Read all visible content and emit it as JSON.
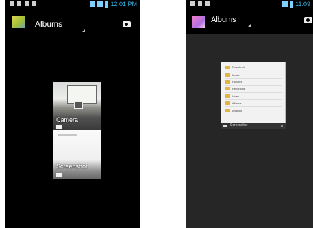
{
  "left_screen": {
    "status": {
      "time": "12:01 PM"
    },
    "actionbar": {
      "title": "Albums"
    },
    "albums": [
      {
        "label": "Camera"
      },
      {
        "label": "Screenshot"
      }
    ]
  },
  "right_screen": {
    "status": {
      "time": "11:09"
    },
    "actionbar": {
      "title": "Albums"
    },
    "file_popup": {
      "items": [
        "Download",
        "Music",
        "Pictures",
        "Recording",
        "Video",
        "Albums",
        "Android"
      ],
      "footer_label": "Screenshot"
    }
  },
  "colors": {
    "status_time": "#33b5e5",
    "background": "#000000"
  }
}
